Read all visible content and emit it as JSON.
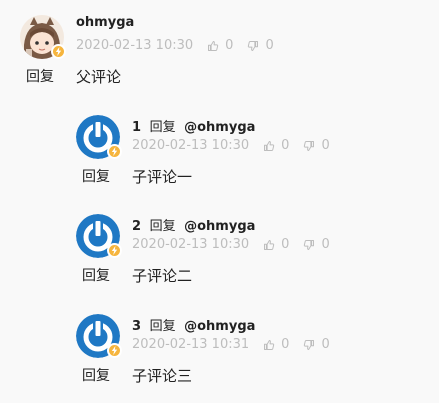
{
  "root": {
    "username": "ohmyga",
    "timestamp": "2020-02-13 10:30",
    "like_count": "0",
    "dislike_count": "0",
    "reply_label": "回复",
    "content": "父评论"
  },
  "replies": [
    {
      "floor": "1",
      "reply_word": "回复",
      "mention": "@ohmyga",
      "timestamp": "2020-02-13 10:30",
      "like_count": "0",
      "dislike_count": "0",
      "reply_label": "回复",
      "content": "子评论一"
    },
    {
      "floor": "2",
      "reply_word": "回复",
      "mention": "@ohmyga",
      "timestamp": "2020-02-13 10:30",
      "like_count": "0",
      "dislike_count": "0",
      "reply_label": "回复",
      "content": "子评论二"
    },
    {
      "floor": "3",
      "reply_word": "回复",
      "mention": "@ohmyga",
      "timestamp": "2020-02-13 10:31",
      "like_count": "0",
      "dislike_count": "0",
      "reply_label": "回复",
      "content": "子评论三"
    }
  ],
  "colors": {
    "badge": "#f6b53e",
    "meta_text": "#bdbdbd",
    "avatar_blue": "#1f78c4"
  },
  "icons": {
    "like": "thumbs-up-icon",
    "dislike": "thumbs-down-icon",
    "badge": "lightning-icon",
    "power": "power-logo-icon"
  }
}
